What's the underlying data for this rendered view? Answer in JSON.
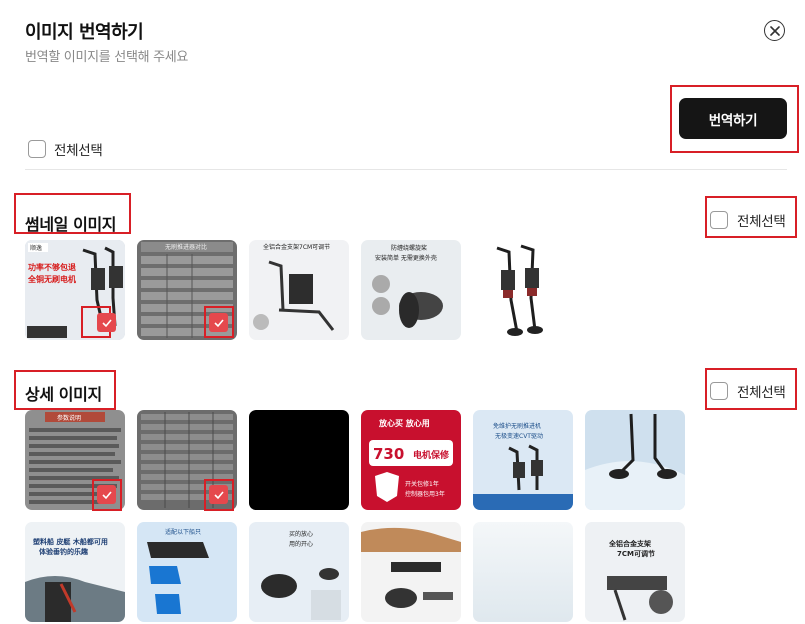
{
  "dialog": {
    "title": "이미지 번역하기",
    "subtitle": "번역할 이미지를 선택해 주세요",
    "translate_label": "번역하기",
    "select_all_label": "전체선택"
  },
  "sections": {
    "thumbnail": {
      "title": "썸네일 이미지",
      "select_all_label": "전체선택",
      "images": [
        {
          "texts": [
            "顺逸",
            "功率不够包退",
            "全铜无刷电机"
          ],
          "selected": true
        },
        {
          "texts": [
            "无刷推进器对比"
          ],
          "selected": true
        },
        {
          "texts": [
            "全铝合金支架7CM可调节"
          ],
          "selected": false
        },
        {
          "texts": [
            "防缠绕螺旋桨",
            "安装简单 无需更换外壳"
          ],
          "selected": false
        },
        {
          "texts": [],
          "selected": false
        }
      ]
    },
    "detail": {
      "title": "상세 이미지",
      "select_all_label": "전체선택",
      "images": [
        {
          "texts": [
            "参数说明"
          ],
          "selected": true
        },
        {
          "texts": [],
          "selected": true
        },
        {
          "texts": [],
          "selected": false
        },
        {
          "texts": [
            "放心买 放心用",
            "730",
            "电机保修",
            "开关包修1年",
            "控制器包用3年"
          ],
          "selected": false
        },
        {
          "texts": [
            "免维护无刷推进机",
            "无极变速CVT驱动"
          ],
          "selected": false
        },
        {
          "texts": [],
          "selected": false
        },
        {
          "texts": [
            "塑料船 皮艇 木船都可用",
            "体验垂钓的乐趣"
          ],
          "selected": false
        },
        {
          "texts": [
            "适配以下船只"
          ],
          "selected": false
        },
        {
          "texts": [
            "买的放心",
            "用的开心"
          ],
          "selected": false
        },
        {
          "texts": [],
          "selected": false
        },
        {
          "texts": [],
          "selected": false
        },
        {
          "texts": [
            "全铝合金支架",
            "7CM可调节"
          ],
          "selected": false
        }
      ]
    }
  },
  "colors": {
    "annotation_red": "#d81f26",
    "check_badge": "#e5484d",
    "primary_button": "#151515"
  },
  "icons": {
    "close": "close-circle-icon",
    "check": "checkmark-icon"
  }
}
